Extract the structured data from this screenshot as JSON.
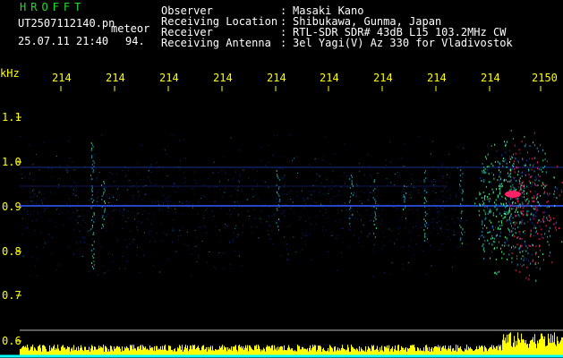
{
  "header": {
    "app_title": "HROFFT",
    "filename": "UT2507112140.pn",
    "event_type": "meteor",
    "date_time": "25.07.11 21:40",
    "count_value": "94.",
    "info_labels": [
      "Observer",
      "Receiving Location",
      "Receiver",
      "Receiving Antenna"
    ],
    "info_separator": ":",
    "info_values": [
      "Masaki Kano",
      "Shibukawa, Gunma, Japan",
      "RTL-SDR SDR# 43dB L15 103.2MHz CW",
      "3el Yagi(V) Az 330 for Vladivostok"
    ]
  },
  "plot": {
    "unit_label": "kHz",
    "time_ticks": [
      "214",
      "214",
      "214",
      "214",
      "214",
      "214",
      "214",
      "214",
      "214",
      "2150"
    ],
    "freq_ticks": [
      "1.1",
      "1.0",
      "0.9",
      "0.8",
      "0.7",
      "0.6"
    ]
  },
  "colors": {
    "background": "#000000",
    "header_title": "#22dd22",
    "text": "#ffffff",
    "tick_text": "#ffff00",
    "carrier_line": "#4466ff",
    "noise_low": "#1133aa",
    "noise_mid": "#22aacc",
    "noise_high": "#44ff88",
    "meteor_head": "#ff2266",
    "level_bar": "#ffff00",
    "baseline": "#00ffff"
  }
}
